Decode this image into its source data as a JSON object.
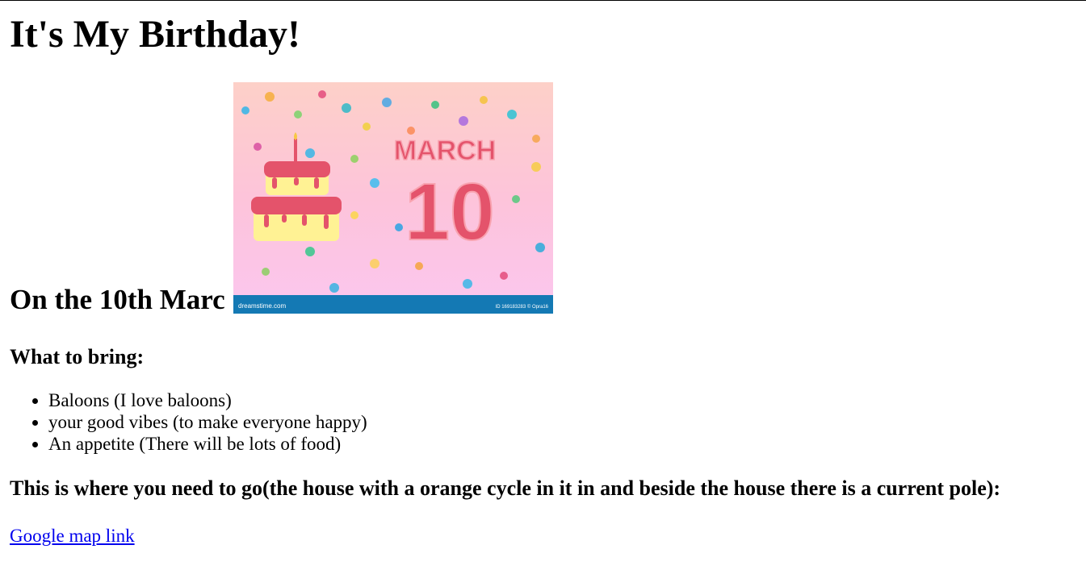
{
  "page": {
    "title": "It's My Birthday!",
    "date_heading": "On the 10th Marc",
    "image": {
      "month_text": "MARCH",
      "day_text": "10",
      "footer_left": "dreamstime.com",
      "footer_right": "ID 169183283 © Opra16"
    },
    "bring_heading": "What to bring:",
    "bring_items": [
      "Baloons (I love baloons)",
      "your good vibes (to make everyone happy)",
      "An appetite (There will be lots of food)"
    ],
    "directions_heading": "This is where you need to go(the house with a orange cycle in it in and beside the house there is a current pole):",
    "map_link_text": "Google map link"
  },
  "colors": {
    "link": "#0000ee",
    "image_top": "#fdd0c8",
    "image_bottom": "#fbc6ef",
    "accent_red": "#e4536b",
    "cake_yellow": "#fff294",
    "footer_blue": "#1479b4"
  }
}
